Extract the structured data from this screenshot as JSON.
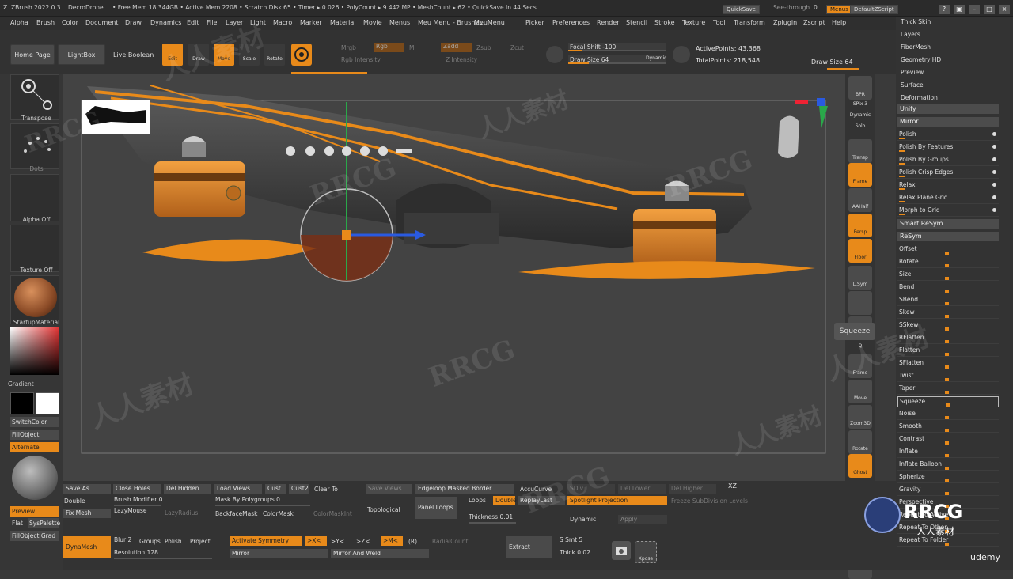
{
  "titlebar": {
    "title": "ZBrush 2022.0.3",
    "doc": "DecroDrone",
    "stats": "• Free Mem 18.344GB • Active Mem 2208 • Scratch Disk 65 • Timer ▸ 0.026 • PolyCount ▸ 9.442 MP • MeshCount ▸ 62 • QuickSave In 44 Secs",
    "quicksave": "QuickSave",
    "seethrough": "See-through",
    "seethrough_value": "0",
    "menus": "Menus",
    "script": "DefaultZScript",
    "win_help": "?",
    "win_min": "–",
    "win_max": "□",
    "win_close": "×"
  },
  "menubar": [
    "Alpha",
    "Brush",
    "Color",
    "Document",
    "Draw",
    "Dynamics",
    "Edit",
    "File",
    "Layer",
    "Light",
    "Macro",
    "Marker",
    "Material",
    "Movie",
    "Menus",
    "Meu Menu - Brushes",
    "MeuMenu",
    "Picker",
    "Preferences",
    "Render",
    "Stencil",
    "Stroke",
    "Texture",
    "Tool",
    "Transform",
    "Zplugin",
    "Zscript",
    "Help"
  ],
  "topshelf": {
    "home": "Home Page",
    "lightbox": "LightBox",
    "live_boolean": "Live Boolean",
    "edit": "Edit",
    "draw": "Draw",
    "move": "Move",
    "scale": "Scale",
    "rotate": "Rotate",
    "mrgb": "Mrgb",
    "rgb": "Rgb",
    "m": "M",
    "rgb_intensity": "Rgb Intensity",
    "zadd": "Zadd",
    "zsub": "Zsub",
    "zcut": "Zcut",
    "z_intensity": "Z Intensity",
    "focal_shift": "Focal Shift -100",
    "draw_size": "Draw Size 64",
    "dynamic": "Dynamic",
    "active_points": "ActivePoints: 43,368",
    "total_points": "TotalPoints: 218,548",
    "draw_size_right": "Draw Size 64"
  },
  "leftpanel": {
    "transpose": "Transpose",
    "dots": "Dots",
    "alpha_off": "Alpha Off",
    "texture_off": "Texture Off",
    "startup_material": "StartupMaterial",
    "gradient": "Gradient",
    "switch_color": "SwitchColor",
    "fill_object": "FillObject",
    "alternate": "Alternate",
    "preview": "Preview",
    "flat": "Flat",
    "sys_palette": "SysPalette",
    "fill_object_grad": "FillObject Grad"
  },
  "rightshelf": [
    "BPR",
    "SPix 3",
    "Dynamic",
    "Solo",
    "Transp",
    "Frame",
    "AAHalf",
    "Persp",
    "Floor",
    "L.Sym",
    "",
    "",
    "Squeeze",
    "Q",
    "Frame",
    "Move",
    "Zoom3D",
    "Rotate",
    "Ghost",
    "Actual",
    "",
    "",
    ""
  ],
  "rightpanel": {
    "top_items": [
      "Thick Skin",
      "Layers",
      "FiberMesh",
      "Geometry HD",
      "Preview",
      "Surface",
      "Deformation"
    ],
    "unify": "Unify",
    "mirror": "Mirror",
    "deform_items": [
      "Polish",
      "Polish By Features",
      "Polish By Groups",
      "Polish Crisp Edges",
      "Relax",
      "Relax Plane Grid",
      "Morph to Grid"
    ],
    "smart_resym": "Smart ReSym",
    "resym": "ReSym",
    "sliders": [
      "Offset",
      "Rotate",
      "Size",
      "Bend",
      "SBend",
      "Skew",
      "SSkew",
      "RFlatten",
      "Flatten",
      "SFlatten",
      "Twist",
      "Taper",
      "Squeeze",
      "Noise",
      "Smooth",
      "Contrast",
      "Inflate",
      "Inflate Balloon",
      "Spherize",
      "Gravity",
      "Perspective",
      "Repeat To Active",
      "Repeat To Other",
      "Repeat To Folder"
    ],
    "selected": "Squeeze"
  },
  "bottom": {
    "save_as": "Save As",
    "close_holes": "Close Holes",
    "del_hidden": "Del Hidden",
    "load_views": "Load Views",
    "cust1": "Cust1",
    "cust2": "Cust2",
    "clear_to": "Clear To",
    "save_views": "Save Views",
    "edgeloop": "Edgeloop Masked Border",
    "accucurve": "AccuCurve",
    "sdiv": "SDiv",
    "del_lower": "Del Lower",
    "del_higher": "Del Higher",
    "xz": "XZ",
    "double": "Double",
    "brush_modifier": "Brush Modifier 0",
    "mask_by_polygroups": "Mask By Polygroups 0",
    "topological": "Topological",
    "panel_loops": "Panel Loops",
    "loops": "Loops",
    "double2": "Double",
    "replay_last": "ReplayLast",
    "spotlight": "Spotlight Projection",
    "freeze_subdiv": "Freeze SubDivision Levels",
    "fix_mesh": "Fix Mesh",
    "lazy_mouse": "LazyMouse",
    "lazy_radius": "LazyRadius",
    "backface_mask": "BackfaceMask",
    "color_mask": "ColorMask",
    "color_mask_int": "ColorMaskInt",
    "thickness": "Thickness 0.01",
    "dynamic": "Dynamic",
    "apply": "Apply",
    "dynamesh": "DynaMesh",
    "blur": "Blur 2",
    "groups": "Groups",
    "polish": "Polish",
    "project": "Project",
    "activate_symmetry": "Activate Symmetry",
    "x": ">X<",
    "y": ">Y<",
    "z": ">Z<",
    "m": ">M<",
    "r": "(R)",
    "radial_count": "RadialCount",
    "extract": "Extract",
    "s_smt": "S Smt 5",
    "thick": "Thick 0.02",
    "resolution": "Resolution 128",
    "mirror": "Mirror",
    "mirror_and_weld": "Mirror And Weld",
    "xpose": "Xpose"
  },
  "watermarks": [
    "RRCG",
    "人人素材",
    "RRCG",
    "人人素材",
    "RRCG",
    "人人素材",
    "RRCG",
    "人人素材",
    "RRCG",
    "人人素材"
  ],
  "logo": {
    "text": "RRCG",
    "sub": "人人素材",
    "udemy": "ūdemy"
  },
  "colors": {
    "accent": "#e88a1a",
    "bg": "#3a3a3a"
  }
}
